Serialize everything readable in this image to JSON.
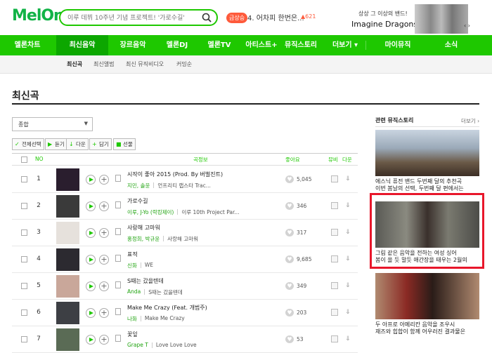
{
  "header": {
    "logo": "MelOn",
    "search_placeholder": "이루 데뷔 10주년 기념 프로젝트! '가로수길'",
    "rank_badge": "급상승",
    "rank_text": "4. 어차피 한번은...",
    "rank_change": "▲621",
    "ad_line1": "상상 그 이상의 밴드!",
    "ad_line2": "Imagine Dragons",
    "ad_nav": "‹ ›"
  },
  "gnb": [
    "멜론차트",
    "최신음악",
    "장르음악",
    "멜론DJ",
    "멜론TV",
    "아티스트+",
    "뮤직스토리",
    "더보기 ▾",
    "마이뮤직",
    "소식"
  ],
  "lnb": [
    "최신곡",
    "최신앨범",
    "최신 뮤직비디오",
    "커밍순"
  ],
  "page_title": "최신곡",
  "filter": {
    "selected": "종합"
  },
  "actions": [
    "전체선택",
    "듣기",
    "다운",
    "담기",
    "선물"
  ],
  "table": {
    "headers": {
      "no": "NO",
      "info": "곡정보",
      "likes": "좋아요",
      "mv": "뮤비",
      "down": "다운"
    },
    "rows": [
      {
        "rank": "1",
        "song": "시작이 좋아 2015 (Prod. By 버벌진트)",
        "artist": "지민, 솔윤",
        "album": "언프리티 랩스타 Trac...",
        "likes": "5,045"
      },
      {
        "rank": "2",
        "song": "가로수길",
        "artist": "이루, J-Yo (락킹제이)",
        "album": "이루 10th Project Par...",
        "likes": "346"
      },
      {
        "rank": "3",
        "song": "사랑해 고마워",
        "artist": "홍정희, 박규윤",
        "album": "사랑해 고마워",
        "likes": "317"
      },
      {
        "rank": "4",
        "song": "표적",
        "artist": "신화",
        "album": "WE",
        "likes": "9,685"
      },
      {
        "rank": "5",
        "song": "S때는 갔을텐데",
        "artist": "Anda",
        "album": "S때는 갔을텐데",
        "likes": "349"
      },
      {
        "rank": "6",
        "song": "Make Me Crazy (Feat. 개범주)",
        "artist": "나화",
        "album": "Make Me Crazy",
        "likes": "203"
      },
      {
        "rank": "7",
        "song": "꽃잎",
        "artist": "Grape T",
        "album": "Love Love Love",
        "likes": "53"
      }
    ]
  },
  "sidebar": {
    "title": "관련 뮤직스토리",
    "more": "더보기 ›",
    "stories": [
      {
        "cap1": "에스닉 퓨전 밴드 두번째 달의 추천곡",
        "cap2": "이번 봄날의 선택, 두번째 달 편에서는"
      },
      {
        "cap1": "그림 같은 음악을 전하는 여성 싱어",
        "cap2": "봄이 올 듯 말듯 애간장을 태우는 2월의"
      },
      {
        "cap1": "두 아프로 아메리칸 음악을 조우시",
        "cap2": "재즈와 힙합이 함께 어우러진 결과물은"
      }
    ]
  }
}
